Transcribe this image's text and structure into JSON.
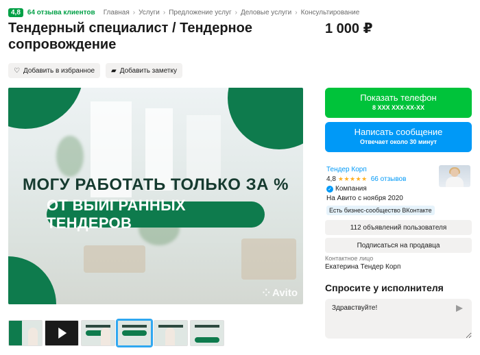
{
  "header": {
    "rating": "4,8",
    "reviews_label": "64 отзыва клиентов",
    "breadcrumbs": [
      "Главная",
      "Услуги",
      "Предложение услуг",
      "Деловые услуги",
      "Консультирование"
    ],
    "title": "Тендерный специалист / Тендерное сопровождение",
    "price": "1 000 ₽"
  },
  "actions": {
    "favorite_label": "Добавить в избранное",
    "favorite_icon": "heart-icon",
    "note_label": "Добавить заметку",
    "note_icon": "note-icon"
  },
  "gallery": {
    "headline_line1": "МОГУ РАБОТАТЬ ТОЛЬКО ЗА %",
    "headline_line2": "ОТ ВЫИГРАННЫХ ТЕНДЕРОВ",
    "watermark": "Avito",
    "accent_color": "#0e7b4d",
    "selected_thumbnail": 4
  },
  "contact_buttons": {
    "phone_label": "Показать телефон",
    "phone_masked": "8 XXX XXX-XX-XX",
    "phone_color": "#00c33a",
    "message_label": "Написать сообщение",
    "message_sub": "Отвечает около 30 минут",
    "message_color": "#0099f7"
  },
  "seller": {
    "name": "Тендер Корп",
    "rating": "4,8",
    "stars": "★★★★★",
    "reviews": "66 отзывов",
    "type": "Компания",
    "since": "На Авито с ноября 2020",
    "community": "Есть бизнес-сообщество ВКонтакте",
    "listings_button": "112 объявлений пользователя",
    "subscribe_button": "Подписаться на продавца",
    "contact_label": "Контактное лицо",
    "contact_name": "Екатерина Тендер Корп"
  },
  "ask": {
    "title": "Спросите у исполнителя",
    "message_value": "Здравствуйте!"
  }
}
